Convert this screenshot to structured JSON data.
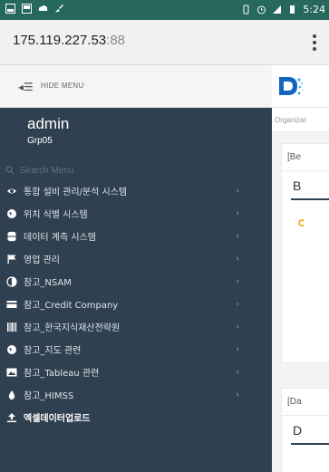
{
  "status_bar": {
    "time": "5:24",
    "left_icons": [
      "gallery-icon",
      "screenshot-icon",
      "cloud-icon",
      "brush-icon"
    ],
    "right_icons": [
      "vibrate-icon",
      "alarm-icon",
      "signal-icon",
      "battery-icon"
    ]
  },
  "browser": {
    "url_host": "175.119.227.53",
    "url_port": ":88"
  },
  "sidebar": {
    "hide_menu_label": "HIDE MENU",
    "user_name": "admin",
    "user_group": "Grp05",
    "search_placeholder": "Search Menu",
    "items": [
      {
        "label": "통합 설비 관리/분석 시스템",
        "icon": "eye-icon"
      },
      {
        "label": "위치 식별 시스템",
        "icon": "globe-icon"
      },
      {
        "label": "데이터 계측 시스템",
        "icon": "database-icon"
      },
      {
        "label": "영업 관리",
        "icon": "flag-icon"
      },
      {
        "label": "참고_NSAM",
        "icon": "half-circle-icon"
      },
      {
        "label": "참고_Credit Company",
        "icon": "credit-card-icon"
      },
      {
        "label": "참고_한국지식재산전략원",
        "icon": "barcode-icon"
      },
      {
        "label": "참고_지도 관련",
        "icon": "globe-icon"
      },
      {
        "label": "참고_Tableau 관련",
        "icon": "image-icon"
      },
      {
        "label": "참고_HIMSS",
        "icon": "drop-icon"
      },
      {
        "label": "엑셀데이터업로드",
        "icon": "upload-icon"
      }
    ]
  },
  "content": {
    "breadcrumb": "Organizat",
    "card1_header": "[Be",
    "card1_title": "B",
    "card2_header": "[Da",
    "card2_title": "D"
  }
}
